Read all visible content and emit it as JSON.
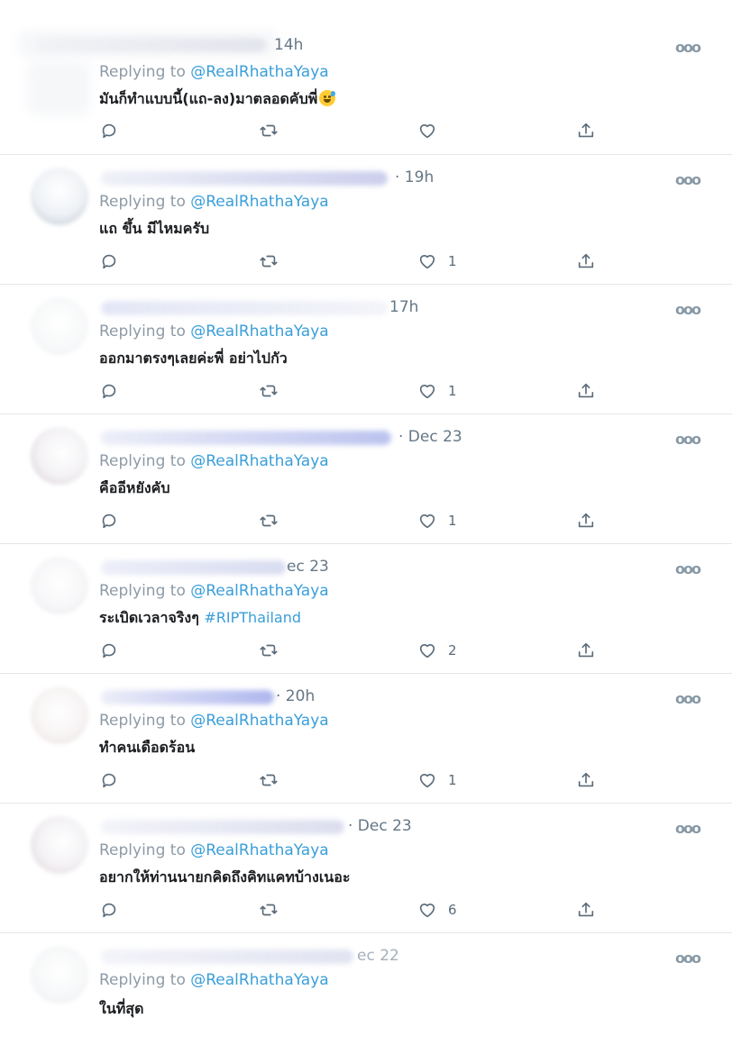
{
  "replying_prefix": "Replying to ",
  "handle": "@RealRhathaYaya",
  "more_label": "ooo",
  "tweets": [
    {
      "time": "14h",
      "text": "มันก็ทำแบบนี้(แถ-ลง)มาตลอดคับพี่",
      "hashtag": "",
      "emoji": "grinning-sweat-emoji",
      "likes": ""
    },
    {
      "time": "· 19h",
      "text": "แถ ขึ้น มีไหมครับ",
      "hashtag": "",
      "likes": "1"
    },
    {
      "time": "17h",
      "text": "ออกมาตรงๆเลยค่ะพี่ อย่าไปกัว",
      "hashtag": "",
      "likes": "1"
    },
    {
      "time": "· Dec 23",
      "text": "คืออีหยังคับ",
      "hashtag": "",
      "likes": "1"
    },
    {
      "time": "ec 23",
      "text": "ระเบิดเวลาจริงๆ ",
      "hashtag": "#RIPThailand",
      "likes": "2"
    },
    {
      "time": "· 20h",
      "text": "ทำคนเดือดร้อน",
      "hashtag": "",
      "likes": "1"
    },
    {
      "time": "· Dec 23",
      "text": "อยากให้ท่านนายกคิดถึงคิทแคทบ้างเนอะ",
      "hashtag": "",
      "likes": "6"
    },
    {
      "time": "ec 22",
      "text": "ในที่สุด",
      "hashtag": "",
      "likes": ""
    }
  ],
  "icons": {
    "reply": "reply-icon",
    "retweet": "retweet-icon",
    "like": "heart-icon",
    "share": "share-icon"
  },
  "colors": {
    "handle": "#3a9ed9",
    "meta": "#657786",
    "icon": "#5b6b79"
  }
}
